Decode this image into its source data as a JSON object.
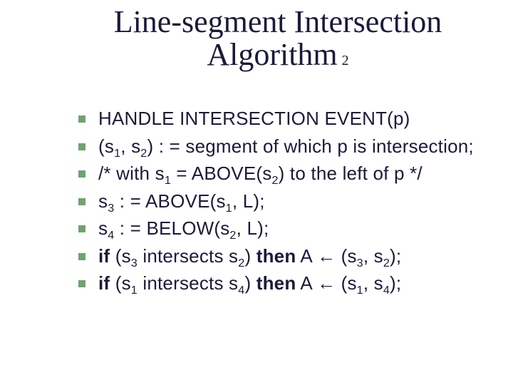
{
  "title": {
    "line1": "Line-segment Intersection",
    "line2": "Algorithm",
    "suffix": "2"
  },
  "bullets": [
    {
      "html": "HANDLE INTERSECTION EVENT(p)"
    },
    {
      "html": "(s<sub>1</sub>, s<sub>2</sub>) : = segment of which p is intersection;"
    },
    {
      "html": "/* with s<sub>1</sub> = ABOVE(s<sub>2</sub>) to the left of p */"
    },
    {
      "html": "s<sub>3</sub> : = ABOVE(s<sub>1</sub>, L);"
    },
    {
      "html": "s<sub>4</sub> : = BELOW(s<sub>2</sub>, L);"
    },
    {
      "html": "<b>if</b> (s<sub>3</sub> intersects s<sub>2</sub>) <b>then</b> A <span class=\"arrow\">←</span> (s<sub>3</sub>, s<sub>2</sub>);"
    },
    {
      "html": "<b>if</b> (s<sub>1</sub> intersects s<sub>4</sub>) <b>then</b> A <span class=\"arrow\">←</span> (s<sub>1</sub>, s<sub>4</sub>);"
    }
  ]
}
